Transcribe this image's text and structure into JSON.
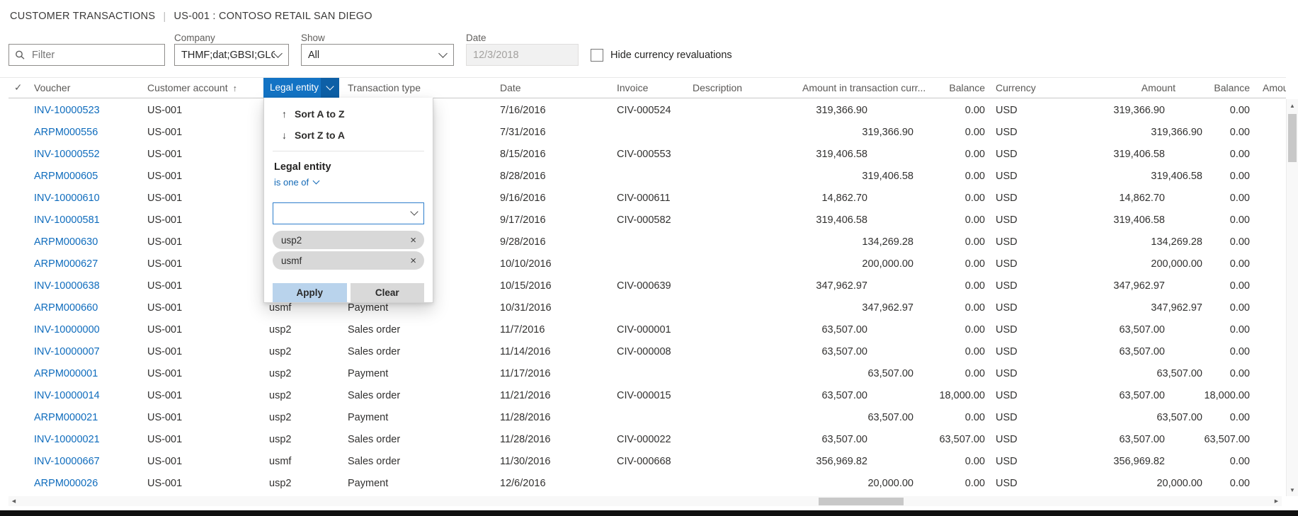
{
  "header": {
    "title": "CUSTOMER TRANSACTIONS",
    "separator": "|",
    "subtitle": "US-001 : CONTOSO RETAIL SAN DIEGO"
  },
  "filter_bar": {
    "filter_placeholder": "Filter",
    "company_label": "Company",
    "company_value": "THMF;dat;GBSI;GLC...",
    "show_label": "Show",
    "show_value": "All",
    "date_label": "Date",
    "date_value": "12/3/2018",
    "date_disabled": true,
    "hide_revaluations_label": "Hide currency revaluations",
    "hide_revaluations_checked": false
  },
  "grid": {
    "columns": [
      "Voucher",
      "Customer account",
      "Legal entity",
      "Transaction type",
      "Date",
      "Invoice",
      "Description",
      "Amount in transaction curr...",
      "Balance",
      "Currency",
      "Amount",
      "Balance",
      "Amount"
    ],
    "sort": {
      "column": "Customer account",
      "direction": "ascending"
    },
    "rows": [
      {
        "voucher": "INV-10000523",
        "account": "US-001",
        "legal_entity": "",
        "type": "",
        "date": "7/16/2016",
        "invoice": "CIV-000524",
        "description": "",
        "amount_transaction": "319,366.90",
        "balance": "0.00",
        "currency": "USD",
        "amount": "319,366.90",
        "balance2": "0.00",
        "credit": false
      },
      {
        "voucher": "ARPM000556",
        "account": "US-001",
        "legal_entity": "",
        "type": "",
        "date": "7/31/2016",
        "invoice": "",
        "description": "",
        "amount_transaction": "319,366.90",
        "balance": "0.00",
        "currency": "USD",
        "amount": "319,366.90",
        "balance2": "0.00",
        "credit": true
      },
      {
        "voucher": "INV-10000552",
        "account": "US-001",
        "legal_entity": "",
        "type": "",
        "date": "8/15/2016",
        "invoice": "CIV-000553",
        "description": "",
        "amount_transaction": "319,406.58",
        "balance": "0.00",
        "currency": "USD",
        "amount": "319,406.58",
        "balance2": "0.00",
        "credit": false
      },
      {
        "voucher": "ARPM000605",
        "account": "US-001",
        "legal_entity": "",
        "type": "",
        "date": "8/28/2016",
        "invoice": "",
        "description": "",
        "amount_transaction": "319,406.58",
        "balance": "0.00",
        "currency": "USD",
        "amount": "319,406.58",
        "balance2": "0.00",
        "credit": true
      },
      {
        "voucher": "INV-10000610",
        "account": "US-001",
        "legal_entity": "",
        "type": "",
        "date": "9/16/2016",
        "invoice": "CIV-000611",
        "description": "",
        "amount_transaction": "14,862.70",
        "balance": "0.00",
        "currency": "USD",
        "amount": "14,862.70",
        "balance2": "0.00",
        "credit": false
      },
      {
        "voucher": "INV-10000581",
        "account": "US-001",
        "legal_entity": "",
        "type": "",
        "date": "9/17/2016",
        "invoice": "CIV-000582",
        "description": "",
        "amount_transaction": "319,406.58",
        "balance": "0.00",
        "currency": "USD",
        "amount": "319,406.58",
        "balance2": "0.00",
        "credit": false
      },
      {
        "voucher": "ARPM000630",
        "account": "US-001",
        "legal_entity": "",
        "type": "",
        "date": "9/28/2016",
        "invoice": "",
        "description": "",
        "amount_transaction": "134,269.28",
        "balance": "0.00",
        "currency": "USD",
        "amount": "134,269.28",
        "balance2": "0.00",
        "credit": true
      },
      {
        "voucher": "ARPM000627",
        "account": "US-001",
        "legal_entity": "",
        "type": "",
        "date": "10/10/2016",
        "invoice": "",
        "description": "",
        "amount_transaction": "200,000.00",
        "balance": "0.00",
        "currency": "USD",
        "amount": "200,000.00",
        "balance2": "0.00",
        "credit": true
      },
      {
        "voucher": "INV-10000638",
        "account": "US-001",
        "legal_entity": "",
        "type": "",
        "date": "10/15/2016",
        "invoice": "CIV-000639",
        "description": "",
        "amount_transaction": "347,962.97",
        "balance": "0.00",
        "currency": "USD",
        "amount": "347,962.97",
        "balance2": "0.00",
        "credit": false
      },
      {
        "voucher": "ARPM000660",
        "account": "US-001",
        "legal_entity": "usmf",
        "type": "Payment",
        "date": "10/31/2016",
        "invoice": "",
        "description": "",
        "amount_transaction": "347,962.97",
        "balance": "0.00",
        "currency": "USD",
        "amount": "347,962.97",
        "balance2": "0.00",
        "credit": true
      },
      {
        "voucher": "INV-10000000",
        "account": "US-001",
        "legal_entity": "usp2",
        "type": "Sales order",
        "date": "11/7/2016",
        "invoice": "CIV-000001",
        "description": "",
        "amount_transaction": "63,507.00",
        "balance": "0.00",
        "currency": "USD",
        "amount": "63,507.00",
        "balance2": "0.00",
        "credit": false
      },
      {
        "voucher": "INV-10000007",
        "account": "US-001",
        "legal_entity": "usp2",
        "type": "Sales order",
        "date": "11/14/2016",
        "invoice": "CIV-000008",
        "description": "",
        "amount_transaction": "63,507.00",
        "balance": "0.00",
        "currency": "USD",
        "amount": "63,507.00",
        "balance2": "0.00",
        "credit": false
      },
      {
        "voucher": "ARPM000001",
        "account": "US-001",
        "legal_entity": "usp2",
        "type": "Payment",
        "date": "11/17/2016",
        "invoice": "",
        "description": "",
        "amount_transaction": "63,507.00",
        "balance": "0.00",
        "currency": "USD",
        "amount": "63,507.00",
        "balance2": "0.00",
        "credit": true
      },
      {
        "voucher": "INV-10000014",
        "account": "US-001",
        "legal_entity": "usp2",
        "type": "Sales order",
        "date": "11/21/2016",
        "invoice": "CIV-000015",
        "description": "",
        "amount_transaction": "63,507.00",
        "balance": "18,000.00",
        "currency": "USD",
        "amount": "63,507.00",
        "balance2": "18,000.00",
        "credit": false
      },
      {
        "voucher": "ARPM000021",
        "account": "US-001",
        "legal_entity": "usp2",
        "type": "Payment",
        "date": "11/28/2016",
        "invoice": "",
        "description": "",
        "amount_transaction": "63,507.00",
        "balance": "0.00",
        "currency": "USD",
        "amount": "63,507.00",
        "balance2": "0.00",
        "credit": true
      },
      {
        "voucher": "INV-10000021",
        "account": "US-001",
        "legal_entity": "usp2",
        "type": "Sales order",
        "date": "11/28/2016",
        "invoice": "CIV-000022",
        "description": "",
        "amount_transaction": "63,507.00",
        "balance": "63,507.00",
        "currency": "USD",
        "amount": "63,507.00",
        "balance2": "63,507.00",
        "credit": false
      },
      {
        "voucher": "INV-10000667",
        "account": "US-001",
        "legal_entity": "usmf",
        "type": "Sales order",
        "date": "11/30/2016",
        "invoice": "CIV-000668",
        "description": "",
        "amount_transaction": "356,969.82",
        "balance": "0.00",
        "currency": "USD",
        "amount": "356,969.82",
        "balance2": "0.00",
        "credit": false
      },
      {
        "voucher": "ARPM000026",
        "account": "US-001",
        "legal_entity": "usp2",
        "type": "Payment",
        "date": "12/6/2016",
        "invoice": "",
        "description": "",
        "amount_transaction": "20,000.00",
        "balance": "0.00",
        "currency": "USD",
        "amount": "20,000.00",
        "balance2": "0.00",
        "credit": true
      }
    ]
  },
  "filter_popup": {
    "sort_az": "Sort A to Z",
    "sort_za": "Sort Z to A",
    "field_label": "Legal entity",
    "operator_label": "is one of",
    "combo_value": "",
    "tags": [
      "usp2",
      "usmf"
    ],
    "apply_label": "Apply",
    "clear_label": "Clear"
  },
  "icons": {
    "check": "✓",
    "sort_asc": "↑",
    "sort_desc": "↓",
    "close": "×",
    "scroll_up": "▲",
    "scroll_down": "▼",
    "scroll_left": "◀",
    "scroll_right": "▶"
  },
  "colors": {
    "link": "#0f6cbd",
    "selected_header_bg": "#1373c4",
    "selected_header_chevron_bg": "#0d5fa6",
    "apply_button_bg": "#b9d3ec",
    "clear_button_bg": "#d9d9d9",
    "tag_bg": "#d8d8d8",
    "disabled_field_bg": "#f1f1f1"
  }
}
